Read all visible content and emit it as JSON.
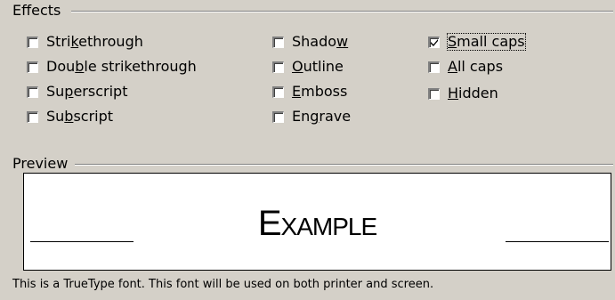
{
  "effects_group": {
    "title_pre": "",
    "title_ul": "",
    "title_post": "Effects",
    "columns": [
      [
        {
          "pre": "Stri",
          "ul": "k",
          "post": "ethrough",
          "checked": false
        },
        {
          "pre": "Dou",
          "ul": "b",
          "post": "le strikethrough",
          "checked": false
        },
        {
          "pre": "Su",
          "ul": "p",
          "post": "erscript",
          "checked": false
        },
        {
          "pre": "Su",
          "ul": "b",
          "post": "script",
          "checked": false
        }
      ],
      [
        {
          "pre": "Shado",
          "ul": "w",
          "post": "",
          "checked": false
        },
        {
          "pre": "",
          "ul": "O",
          "post": "utline",
          "checked": false
        },
        {
          "pre": "",
          "ul": "E",
          "post": "mboss",
          "checked": false
        },
        {
          "pre": "En",
          "ul": "g",
          "post": "rave",
          "checked": false
        }
      ],
      [
        {
          "pre": "",
          "ul": "S",
          "post": "mall caps",
          "checked": true,
          "focused": true
        },
        {
          "pre": "",
          "ul": "A",
          "post": "ll caps",
          "checked": false
        },
        {
          "pre": "",
          "ul": "H",
          "post": "idden",
          "checked": false
        }
      ]
    ]
  },
  "preview_group": {
    "title": "Preview",
    "sample_text": "Example"
  },
  "status_text": "This is a TrueType font. This font will be used on both printer and screen."
}
